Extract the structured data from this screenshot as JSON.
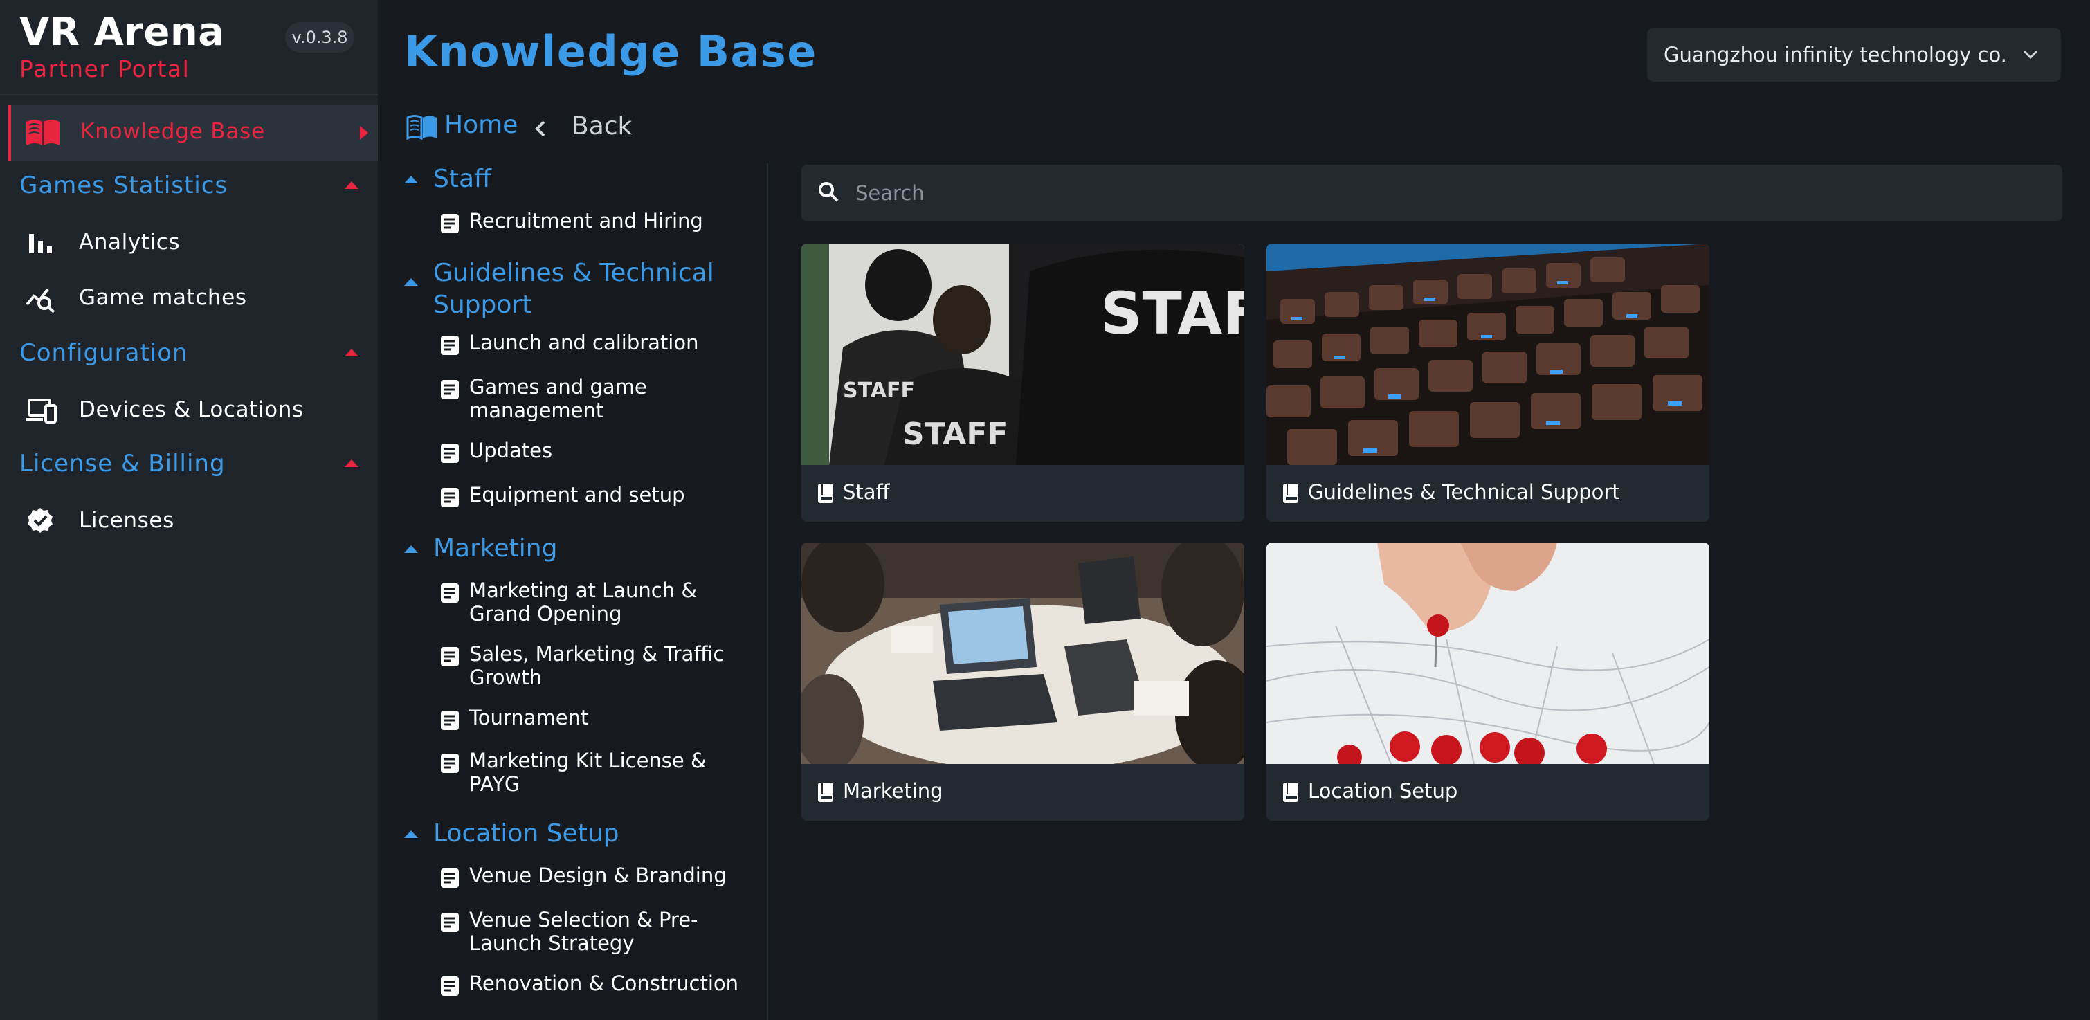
{
  "brand": {
    "title": "VR Arena",
    "subtitle": "Partner Portal",
    "version": "v.0.3.8"
  },
  "sidebar": {
    "active": {
      "label": "Knowledge Base",
      "icon": "book-open-icon"
    },
    "sections": [
      {
        "label": "Games Statistics",
        "items": [
          {
            "label": "Analytics",
            "icon": "bar-chart-icon"
          },
          {
            "label": "Game matches",
            "icon": "chart-search-icon"
          }
        ]
      },
      {
        "label": "Configuration",
        "items": [
          {
            "label": "Devices & Locations",
            "icon": "devices-icon"
          }
        ]
      },
      {
        "label": "License & Billing",
        "items": [
          {
            "label": "Licenses",
            "icon": "verified-badge-icon"
          }
        ]
      }
    ]
  },
  "header": {
    "title": "Knowledge Base",
    "company": "Guangzhou infinity technology co."
  },
  "breadcrumb": {
    "home": "Home",
    "back": "Back"
  },
  "tree": [
    {
      "label": "Staff",
      "docs": [
        "Recruitment and Hiring"
      ]
    },
    {
      "label": "Guidelines & Technical Support",
      "docs": [
        "Launch and calibration",
        "Games and game management",
        "Updates",
        "Equipment and setup"
      ]
    },
    {
      "label": "Marketing",
      "docs": [
        "Marketing at Launch & Grand Opening",
        "Sales, Marketing & Traffic Growth",
        "Tournament",
        "Marketing Kit License & PAYG"
      ]
    },
    {
      "label": "Location Setup",
      "docs": [
        "Venue Design & Branding",
        "Venue Selection & Pre-Launch Strategy",
        "Renovation & Construction"
      ]
    }
  ],
  "search": {
    "placeholder": "Search"
  },
  "cards": [
    {
      "label": "Staff"
    },
    {
      "label": "Guidelines & Technical Support"
    },
    {
      "label": "Marketing"
    },
    {
      "label": "Location Setup"
    }
  ],
  "colors": {
    "accent_blue": "#3b9ae8",
    "accent_red": "#e8243f",
    "sidebar_bg": "#1f242b",
    "page_bg": "#16191d"
  }
}
